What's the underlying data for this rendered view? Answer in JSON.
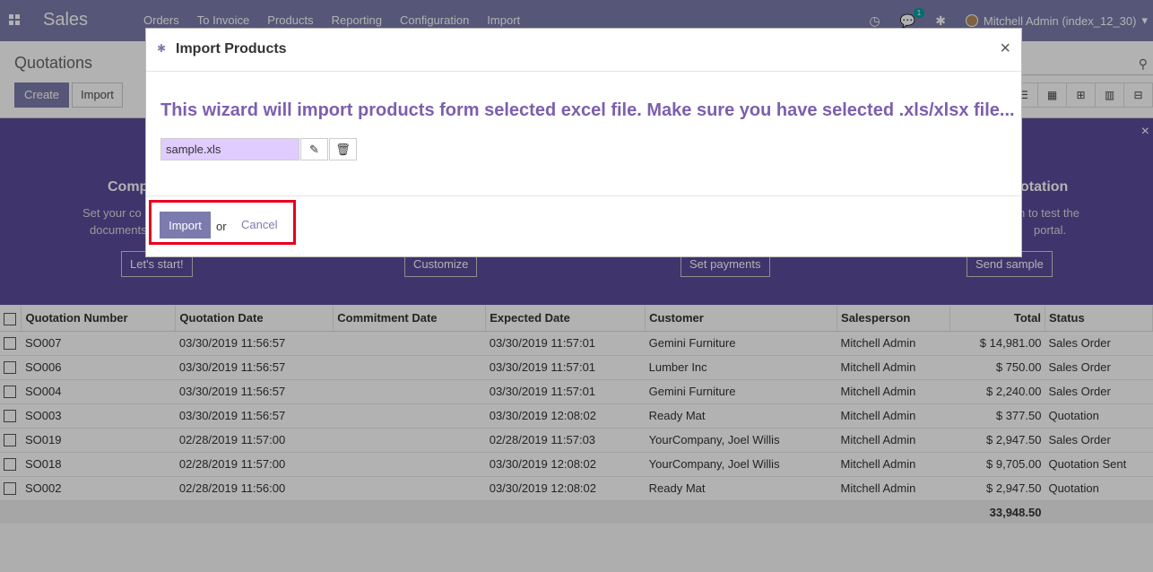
{
  "navbar": {
    "brand": "Sales",
    "menu": [
      "Orders",
      "To Invoice",
      "Products",
      "Reporting",
      "Configuration",
      "Import"
    ],
    "messages_badge": "1",
    "user": "Mitchell Admin (index_12_30)"
  },
  "control_panel": {
    "breadcrumb": "Quotations",
    "create_label": "Create",
    "import_label": "Import"
  },
  "banner": {
    "step1_title": "Comp",
    "step1_text_1": "Set your co",
    "step1_text_2": "documents",
    "step1_button": "Let's start!",
    "step2_button": "Customize",
    "step3_button": "Set payments",
    "step4_title": "otation",
    "step4_text_1": "n to test the",
    "step4_text_2": "portal.",
    "step4_button": "Send sample",
    "close": "×"
  },
  "table": {
    "columns": [
      "Quotation Number",
      "Quotation Date",
      "Commitment Date",
      "Expected Date",
      "Customer",
      "Salesperson",
      "Total",
      "Status"
    ],
    "rows": [
      [
        "SO007",
        "03/30/2019 11:56:57",
        "",
        "03/30/2019 11:57:01",
        "Gemini Furniture",
        "Mitchell Admin",
        "$ 14,981.00",
        "Sales Order"
      ],
      [
        "SO006",
        "03/30/2019 11:56:57",
        "",
        "03/30/2019 11:57:01",
        "Lumber Inc",
        "Mitchell Admin",
        "$ 750.00",
        "Sales Order"
      ],
      [
        "SO004",
        "03/30/2019 11:56:57",
        "",
        "03/30/2019 11:57:01",
        "Gemini Furniture",
        "Mitchell Admin",
        "$ 2,240.00",
        "Sales Order"
      ],
      [
        "SO003",
        "03/30/2019 11:56:57",
        "",
        "03/30/2019 12:08:02",
        "Ready Mat",
        "Mitchell Admin",
        "$ 377.50",
        "Quotation"
      ],
      [
        "SO019",
        "02/28/2019 11:57:00",
        "",
        "02/28/2019 11:57:03",
        "YourCompany, Joel Willis",
        "Mitchell Admin",
        "$ 2,947.50",
        "Sales Order"
      ],
      [
        "SO018",
        "02/28/2019 11:57:00",
        "",
        "03/30/2019 12:08:02",
        "YourCompany, Joel Willis",
        "Mitchell Admin",
        "$ 9,705.00",
        "Quotation Sent"
      ],
      [
        "SO002",
        "02/28/2019 11:56:00",
        "",
        "03/30/2019 12:08:02",
        "Ready Mat",
        "Mitchell Admin",
        "$ 2,947.50",
        "Quotation"
      ]
    ],
    "grand_total": "33,948.50"
  },
  "modal": {
    "title": "Import Products",
    "close": "×",
    "message": "This wizard will import products form selected excel file. Make sure you have selected .xls/xlsx file...",
    "file_name": "sample.xls",
    "import_label": "Import",
    "or_label": "or",
    "cancel_label": "Cancel"
  },
  "colors": {
    "primary": "#7c7bad",
    "wizard_text": "#7c5fae",
    "highlight": "#e8001c",
    "file_bg": "#e0ccff"
  }
}
